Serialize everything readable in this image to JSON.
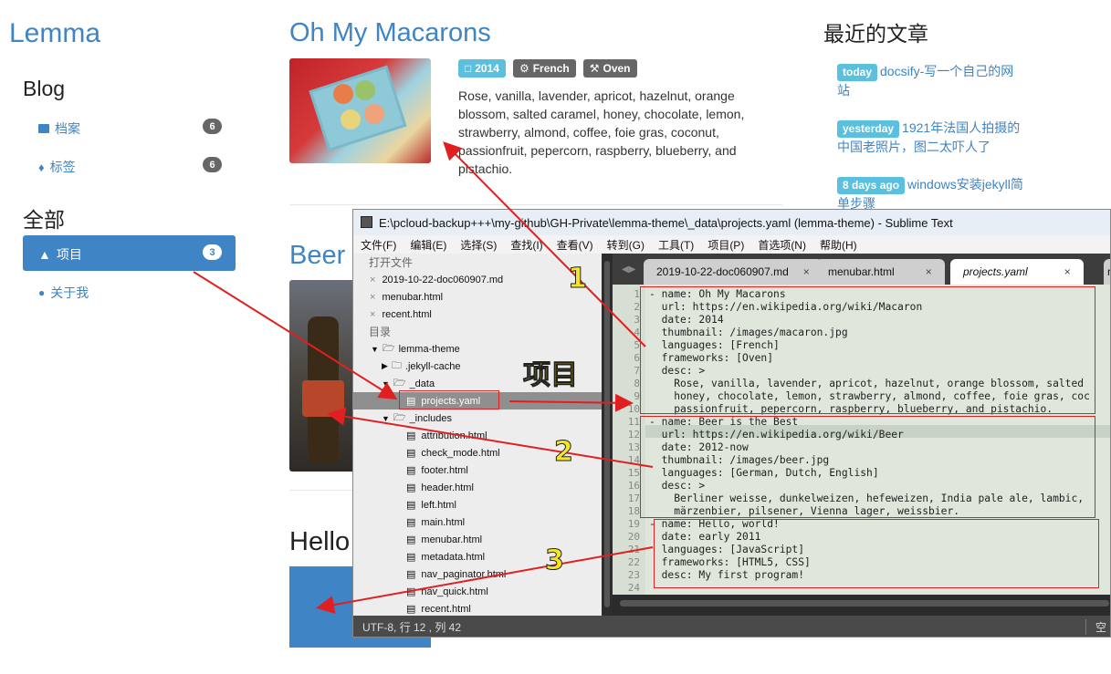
{
  "site": {
    "title": "Lemma"
  },
  "sidebar": {
    "blog_heading": "Blog",
    "items": [
      {
        "label": "档案",
        "count": "6"
      },
      {
        "label": "标签",
        "count": "6"
      }
    ],
    "all_heading": "全部",
    "projects": {
      "label": "项目",
      "count": "3"
    },
    "about": {
      "label": "关于我"
    }
  },
  "posts": [
    {
      "title": "Oh My Macarons",
      "tags": [
        "2014",
        "French",
        "Oven"
      ],
      "desc": "Rose, vanilla, lavender, apricot, hazelnut, orange blossom, salted caramel, honey, chocolate, lemon, strawberry, almond, coffee, foie gras, coconut, passionfruit, pepercorn, raspberry, blueberry, and pistachio."
    },
    {
      "title": "Beer"
    },
    {
      "title": "Hello"
    }
  ],
  "recent": {
    "heading": "最近的文章",
    "items": [
      {
        "badge": "today",
        "text": "docsify-写一个自己的网站"
      },
      {
        "badge": "yesterday",
        "text": "1921年法国人拍摄的中国老照片，图二太吓人了"
      },
      {
        "badge": "8 days ago",
        "text": "windows安装jekyll简单步骤"
      }
    ]
  },
  "sublime": {
    "title": "E:\\pcloud-backup+++\\my-github\\GH-Private\\lemma-theme\\_data\\projects.yaml (lemma-theme) - Sublime Text",
    "menu": [
      "文件(F)",
      "编辑(E)",
      "选择(S)",
      "查找(I)",
      "查看(V)",
      "转到(G)",
      "工具(T)",
      "项目(P)",
      "首选项(N)",
      "帮助(H)"
    ],
    "open_files_label": "打开文件",
    "open_files": [
      "2019-10-22-doc060907.md",
      "menubar.html",
      "recent.html"
    ],
    "folders_label": "目录",
    "tree": {
      "root": "lemma-theme",
      "jekyll_cache": ".jekyll-cache",
      "data": "_data",
      "projects": "projects.yaml",
      "includes": "_includes",
      "files": [
        "attribution.html",
        "check_mode.html",
        "footer.html",
        "header.html",
        "left.html",
        "main.html",
        "menubar.html",
        "metadata.html",
        "nav_paginator.html",
        "nav_quick.html",
        "recent.html"
      ]
    },
    "tabs": [
      "2019-10-22-doc060907.md",
      "menubar.html",
      "projects.yaml"
    ],
    "code": [
      "- name: Oh My Macarons",
      "  url: https://en.wikipedia.org/wiki/Macaron",
      "  date: 2014",
      "  thumbnail: /images/macaron.jpg",
      "  languages: [French]",
      "  frameworks: [Oven]",
      "  desc: >",
      "    Rose, vanilla, lavender, apricot, hazelnut, orange blossom, salted",
      "    honey, chocolate, lemon, strawberry, almond, coffee, foie gras, coc",
      "    passionfruit, pepercorn, raspberry, blueberry, and pistachio.",
      "- name: Beer is the Best",
      "  url: https://en.wikipedia.org/wiki/Beer",
      "  date: 2012-now",
      "  thumbnail: /images/beer.jpg",
      "  languages: [German, Dutch, English]",
      "  desc: >",
      "    Berliner weisse, dunkelweizen, hefeweizen, India pale ale, lambic,",
      "    märzenbier, pilsener, Vienna lager, weissbier.",
      "- name: Hello, world!",
      "  date: early 2011",
      "  languages: [JavaScript]",
      "  frameworks: [HTML5, CSS]",
      "  desc: My first program!",
      ""
    ],
    "status": "UTF-8, 行 12 , 列 42",
    "status_right": "空"
  },
  "annotations": {
    "n1": "1",
    "n2": "2",
    "n3": "3",
    "label": "项目"
  },
  "colors": {
    "accent": "#3f84c4",
    "badge": "#5bc0de",
    "tag_gray": "#666666",
    "arrow": "#e02020"
  }
}
